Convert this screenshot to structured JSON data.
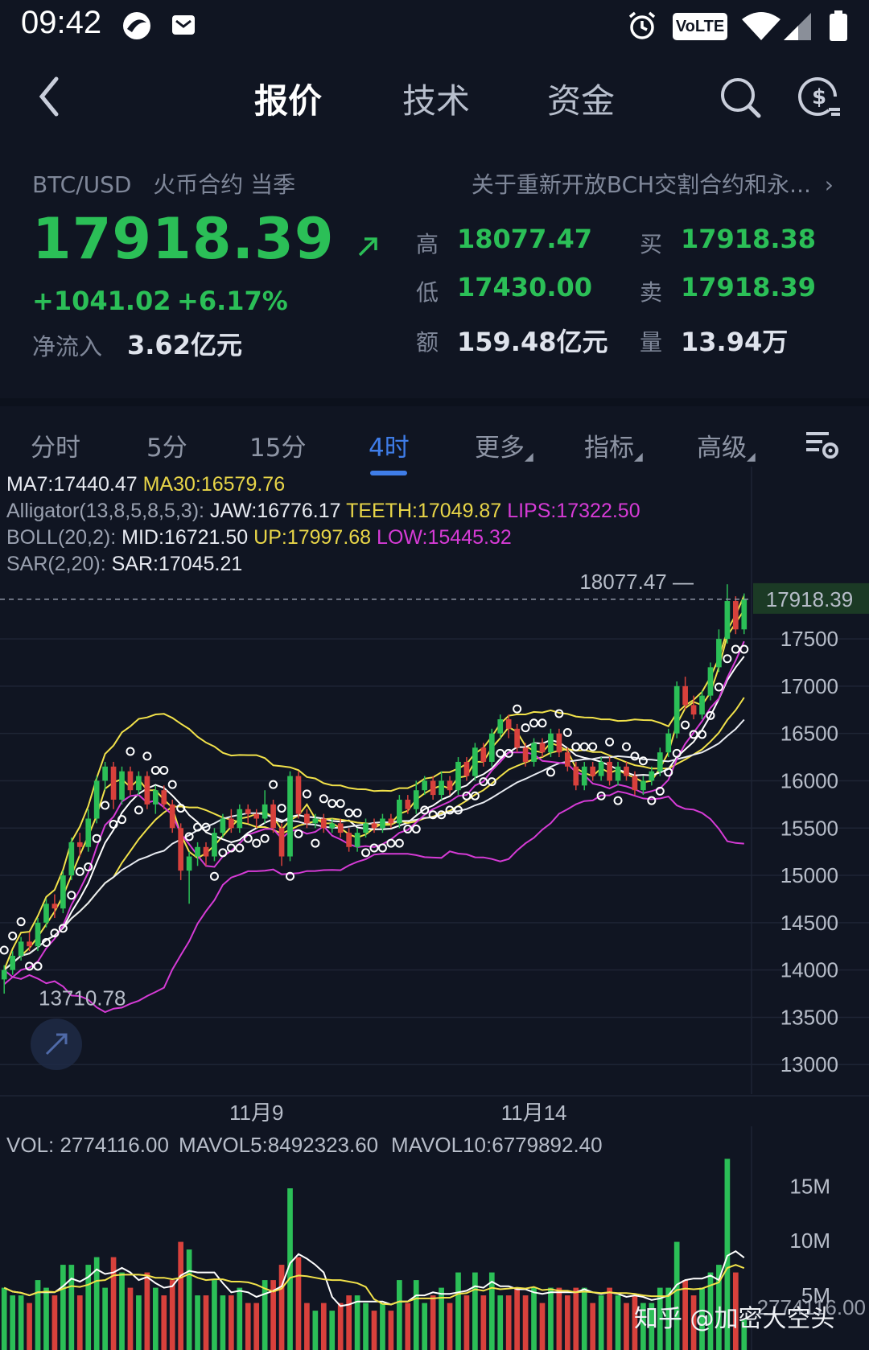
{
  "status_bar": {
    "time": "09:42",
    "volte": "VoLTE"
  },
  "nav": {
    "tabs": [
      {
        "label": "报价",
        "active": true
      },
      {
        "label": "技术"
      },
      {
        "label": "资金"
      }
    ]
  },
  "quote": {
    "pair": "BTC/USD",
    "exchange": "火币合约 当季",
    "notice": "关于重新开放BCH交割合约和永...",
    "last_price": "17918.39",
    "change": "+1041.02",
    "change_pct": "+6.17%",
    "net_inflow_label": "净流入",
    "net_inflow": "3.62亿元",
    "stats": {
      "high_label": "高",
      "high": "18077.47",
      "low_label": "低",
      "low": "17430.00",
      "amount_label": "额",
      "amount": "159.48亿元",
      "bid_label": "买",
      "bid": "17918.38",
      "ask_label": "卖",
      "ask": "17918.39",
      "volume_label": "量",
      "volume": "13.94万"
    },
    "colors": {
      "up": "#2bbf57",
      "down": "#d8413c",
      "accent": "#3f7de8"
    }
  },
  "period_tabs": [
    {
      "label": "分时"
    },
    {
      "label": "5分"
    },
    {
      "label": "15分"
    },
    {
      "label": "4时",
      "active": true
    },
    {
      "label": "更多"
    },
    {
      "label": "指标"
    },
    {
      "label": "高级"
    }
  ],
  "indicators": {
    "ma7": "MA7:17440.47",
    "ma30": "MA30:16579.76",
    "alligator_label": "Alligator(13,8,5,8,5,3):",
    "jaw": "JAW:16776.17",
    "teeth": "TEETH:17049.87",
    "lips": "LIPS:17322.50",
    "boll_label": "BOLL(20,2):",
    "mid": "MID:16721.50",
    "up": "UP:17997.68",
    "low": "LOW:15445.32",
    "sar_label": "SAR(2,20):",
    "sar": "SAR:17045.21"
  },
  "chart_data": [
    {
      "type": "candlestick",
      "y_ticks": [
        17500,
        17000,
        16500,
        16000,
        15500,
        15000,
        14500,
        14000,
        13500,
        13000
      ],
      "ylim": [
        12900,
        18300
      ],
      "x_ticks": [
        "11月9",
        "11月14"
      ],
      "last_price_label": "17918.39",
      "high_marker": "18077.47",
      "low_marker": "13710.78",
      "last_price": 17918.39,
      "high_value": 18077.47,
      "low_value": 13710.78,
      "candles": [
        [
          13900,
          14000,
          13750,
          14050
        ],
        [
          14000,
          14150,
          13950,
          14200
        ],
        [
          14150,
          14300,
          14100,
          14350
        ],
        [
          14300,
          14250,
          14200,
          14400
        ],
        [
          14250,
          14500,
          14200,
          14550
        ],
        [
          14500,
          14700,
          14450,
          14750
        ],
        [
          14700,
          14650,
          14550,
          14800
        ],
        [
          14650,
          15000,
          14600,
          15050
        ],
        [
          15000,
          15350,
          14950,
          15400
        ],
        [
          15350,
          15300,
          15200,
          15450
        ],
        [
          15300,
          15600,
          15250,
          15700
        ],
        [
          15600,
          16000,
          15550,
          16050
        ],
        [
          16000,
          16150,
          15900,
          16200
        ],
        [
          16150,
          15800,
          15700,
          16200
        ],
        [
          15800,
          16100,
          15750,
          16150
        ],
        [
          16100,
          15900,
          15850,
          16150
        ],
        [
          15900,
          16050,
          15850,
          16100
        ],
        [
          16050,
          15750,
          15700,
          16100
        ],
        [
          15750,
          15900,
          15650,
          15950
        ],
        [
          15900,
          15750,
          15700,
          15950
        ],
        [
          15750,
          15500,
          15450,
          15800
        ],
        [
          15500,
          15050,
          14950,
          15550
        ],
        [
          15050,
          15200,
          14700,
          15250
        ],
        [
          15200,
          15300,
          15100,
          15350
        ],
        [
          15300,
          15200,
          15100,
          15350
        ],
        [
          15200,
          15450,
          15150,
          15500
        ],
        [
          15450,
          15600,
          15400,
          15650
        ],
        [
          15600,
          15500,
          15450,
          15700
        ],
        [
          15500,
          15700,
          15450,
          15750
        ],
        [
          15700,
          15650,
          15550,
          15750
        ],
        [
          15650,
          15600,
          15500,
          15700
        ],
        [
          15600,
          15750,
          15550,
          15900
        ],
        [
          15750,
          15500,
          15450,
          15800
        ],
        [
          15500,
          15200,
          15100,
          15550
        ],
        [
          15200,
          16050,
          15150,
          16100
        ],
        [
          16050,
          15650,
          15600,
          16100
        ],
        [
          15650,
          15550,
          15500,
          15700
        ],
        [
          15550,
          15600,
          15500,
          15650
        ],
        [
          15600,
          15500,
          15450,
          15650
        ],
        [
          15500,
          15550,
          15450,
          15600
        ],
        [
          15550,
          15450,
          15400,
          15600
        ],
        [
          15450,
          15300,
          15250,
          15500
        ],
        [
          15300,
          15450,
          15250,
          15500
        ],
        [
          15450,
          15550,
          15400,
          15600
        ],
        [
          15550,
          15500,
          15450,
          15600
        ],
        [
          15500,
          15600,
          15450,
          15650
        ],
        [
          15600,
          15550,
          15500,
          15650
        ],
        [
          15550,
          15800,
          15500,
          15850
        ],
        [
          15800,
          15700,
          15650,
          15850
        ],
        [
          15700,
          15900,
          15650,
          16000
        ],
        [
          15900,
          16000,
          15850,
          16050
        ],
        [
          16000,
          15850,
          15800,
          16050
        ],
        [
          15850,
          16000,
          15800,
          16100
        ],
        [
          16000,
          15900,
          15850,
          16050
        ],
        [
          15900,
          16200,
          15850,
          16250
        ],
        [
          16200,
          16050,
          16000,
          16250
        ],
        [
          16050,
          16350,
          16000,
          16400
        ],
        [
          16350,
          16200,
          16150,
          16400
        ],
        [
          16200,
          16500,
          16150,
          16550
        ],
        [
          16500,
          16650,
          16450,
          16700
        ],
        [
          16650,
          16550,
          16450,
          16700
        ],
        [
          16550,
          16350,
          16300,
          16600
        ],
        [
          16350,
          16200,
          16150,
          16400
        ],
        [
          16200,
          16400,
          16150,
          16450
        ],
        [
          16400,
          16300,
          16250,
          16450
        ],
        [
          16300,
          16500,
          16250,
          16550
        ],
        [
          16500,
          16300,
          16250,
          16550
        ],
        [
          16300,
          16150,
          16100,
          16350
        ],
        [
          16150,
          15950,
          15900,
          16200
        ],
        [
          15950,
          16150,
          15900,
          16200
        ],
        [
          16150,
          16050,
          16000,
          16200
        ],
        [
          16050,
          16200,
          16000,
          16250
        ],
        [
          16200,
          16000,
          15950,
          16250
        ],
        [
          16000,
          16150,
          15950,
          16200
        ],
        [
          16150,
          16050,
          16000,
          16200
        ],
        [
          16050,
          15900,
          15850,
          16100
        ],
        [
          15900,
          16000,
          15850,
          16050
        ],
        [
          16000,
          16100,
          15950,
          16150
        ],
        [
          16100,
          16300,
          16050,
          16350
        ],
        [
          16300,
          16500,
          16250,
          16550
        ],
        [
          16500,
          17000,
          16450,
          17050
        ],
        [
          17000,
          16800,
          16750,
          17100
        ],
        [
          16800,
          16700,
          16650,
          16900
        ],
        [
          16700,
          16900,
          16650,
          16950
        ],
        [
          16900,
          17200,
          16850,
          17250
        ],
        [
          17200,
          17500,
          17150,
          17600
        ],
        [
          17500,
          17900,
          17450,
          18077
        ],
        [
          17900,
          17600,
          17550,
          17950
        ],
        [
          17600,
          17918,
          17550,
          17980
        ]
      ]
    },
    {
      "type": "bar",
      "title": "",
      "y_ticks": [
        "15M",
        "10M",
        "5M"
      ],
      "ylim": [
        0,
        19000000
      ],
      "vol_label": "VOL: 2774116.00",
      "mavol5": "MAVOL5:8492323.60",
      "mavol10": "MAVOL10:6779892.40",
      "last_vol_label": "2774116.00"
    }
  ],
  "watermark": "知乎 @加密大空头"
}
